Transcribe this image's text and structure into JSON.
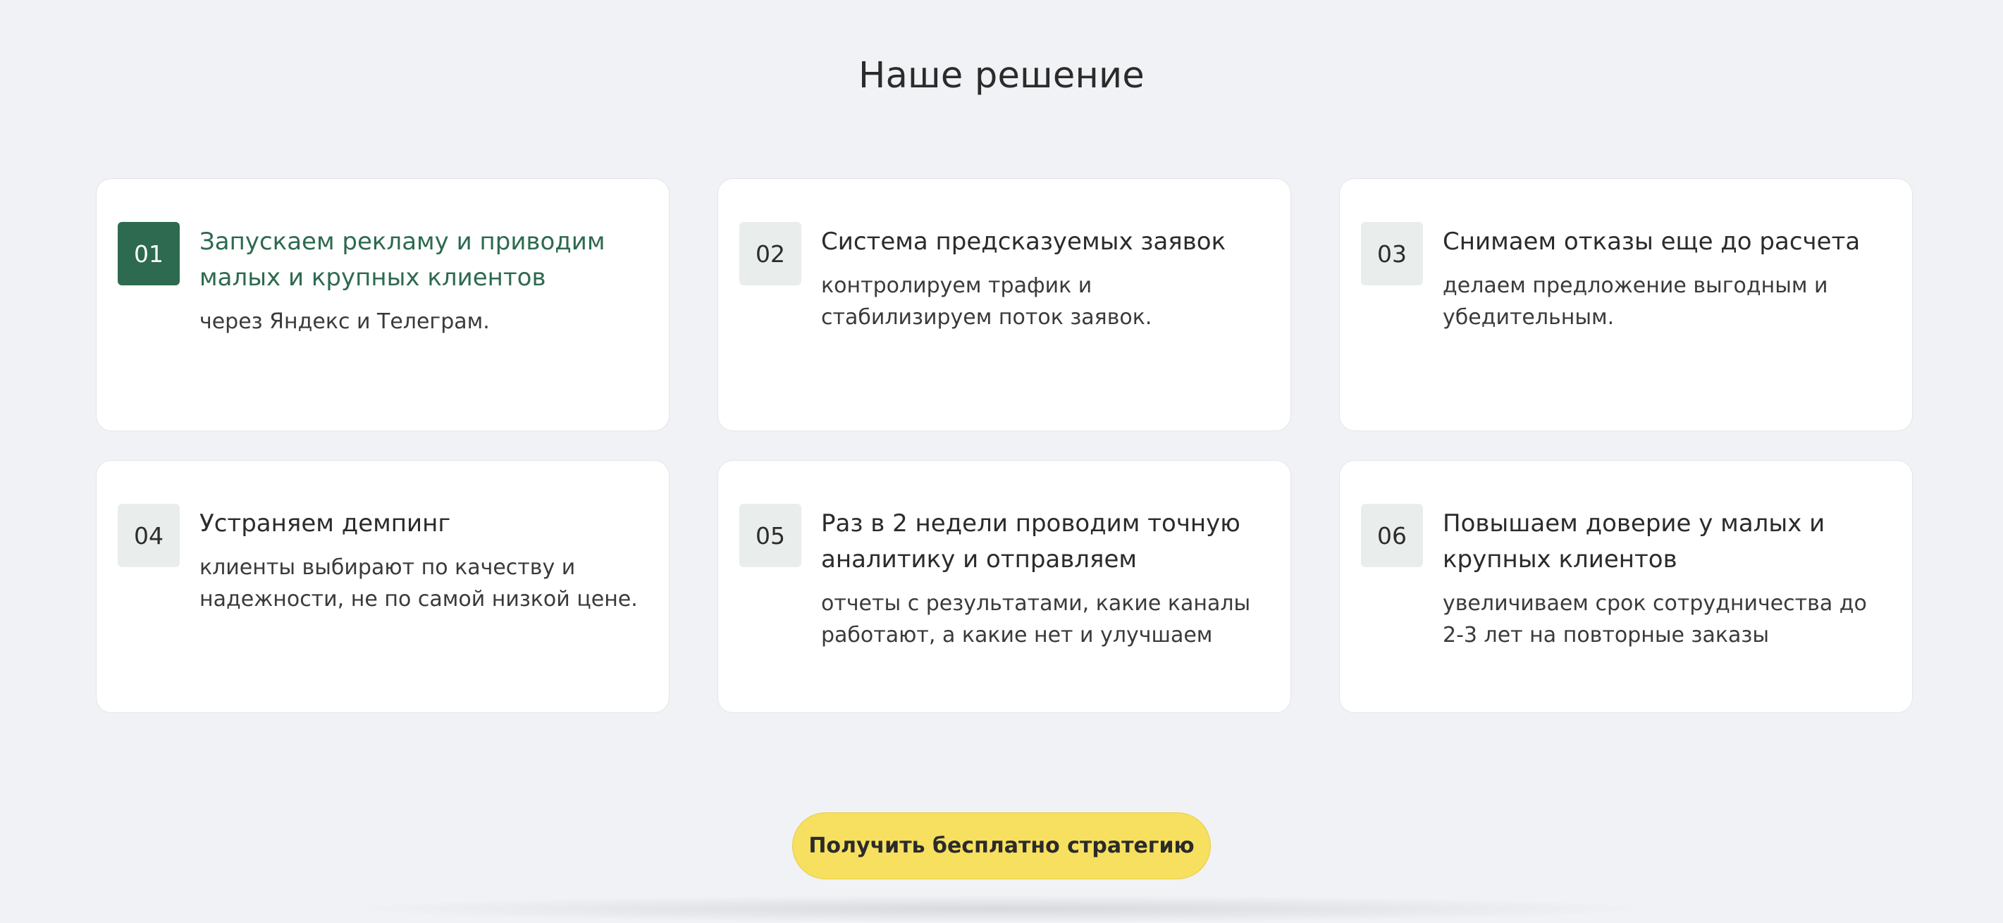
{
  "section": {
    "title": "Наше решение"
  },
  "cards": [
    {
      "number": "01",
      "title": "Запускаем рекламу и приводим малых и крупных клиентов",
      "description": "через Яндекс и Телеграм.",
      "active": true
    },
    {
      "number": "02",
      "title": "Система предсказуемых заявок",
      "description": "контролируем трафик и стабилизируем поток заявок.",
      "active": false
    },
    {
      "number": "03",
      "title": "Снимаем отказы еще до расчета",
      "description": "делаем предложение выгодным и убедительным.",
      "active": false
    },
    {
      "number": "04",
      "title": "Устраняем демпинг",
      "description": "клиенты выбирают по качеству и надежности, не по самой низкой цене.",
      "active": false
    },
    {
      "number": "05",
      "title": "Раз в 2 недели проводим точную аналитику и отправляем",
      "description": "отчеты с результатами, какие каналы работают, а какие нет и улучшаем",
      "active": false
    },
    {
      "number": "06",
      "title": "Повышаем доверие у малых и крупных клиентов",
      "description": "увеличиваем срок сотрудничества до 2-3 лет на повторные заказы",
      "active": false
    }
  ],
  "cta": {
    "label": "Получить бесплатно стратегию"
  },
  "colors": {
    "background": "#f1f2f5",
    "accent_green": "#2d6a4f",
    "badge_inactive": "#e9eeec",
    "cta_yellow": "#f7e05f"
  }
}
